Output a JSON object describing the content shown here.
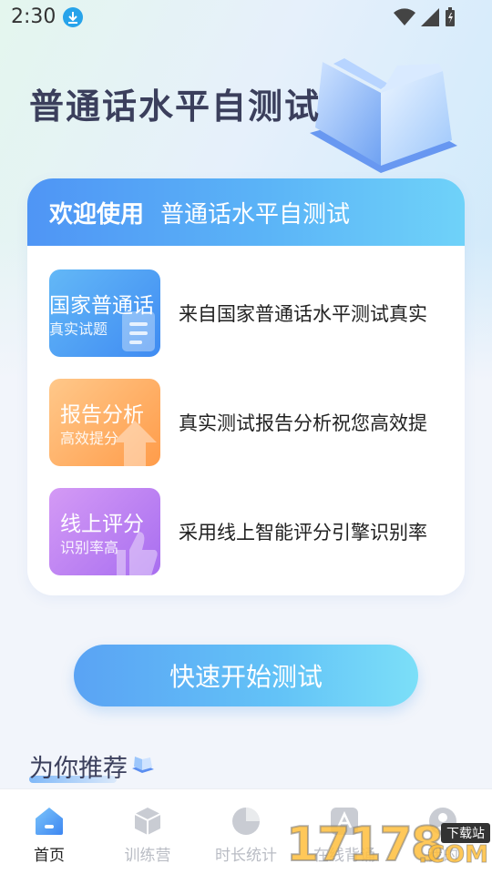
{
  "status_bar": {
    "time": "2:30"
  },
  "hero": {
    "title": "普通话水平自测试"
  },
  "welcome_card": {
    "welcome_label": "欢迎使用",
    "app_name": "普通话水平自测试",
    "features": [
      {
        "tile_title": "国家普通话",
        "tile_subtitle": "真实试题",
        "description": "来自国家普通话水平测试真实",
        "color": "#4a97f4"
      },
      {
        "tile_title": "报告分析",
        "tile_subtitle": "高效提分",
        "description": "真实测试报告分析祝您高效提",
        "color": "#ffa85c"
      },
      {
        "tile_title": "线上评分",
        "tile_subtitle": "识别率高",
        "description": "采用线上智能评分引擎识别率",
        "color": "#b67ef2"
      }
    ]
  },
  "start_button": {
    "label": "快速开始测试"
  },
  "recommend": {
    "title": "为你推荐"
  },
  "bottom_nav": {
    "items": [
      {
        "label": "首页",
        "icon": "home-icon",
        "active": true
      },
      {
        "label": "训练营",
        "icon": "cube-icon",
        "active": false
      },
      {
        "label": "时长统计",
        "icon": "pie-chart-icon",
        "active": false
      },
      {
        "label": "在线背诵",
        "icon": "text-icon",
        "active": false
      },
      {
        "label": "我的",
        "icon": "profile-icon",
        "active": false
      }
    ]
  },
  "watermark": {
    "digits": "17178",
    "suffix": ".COM",
    "tag": "下载站"
  },
  "colors": {
    "accent": "#4f95f5",
    "title": "#3b3f5c"
  }
}
